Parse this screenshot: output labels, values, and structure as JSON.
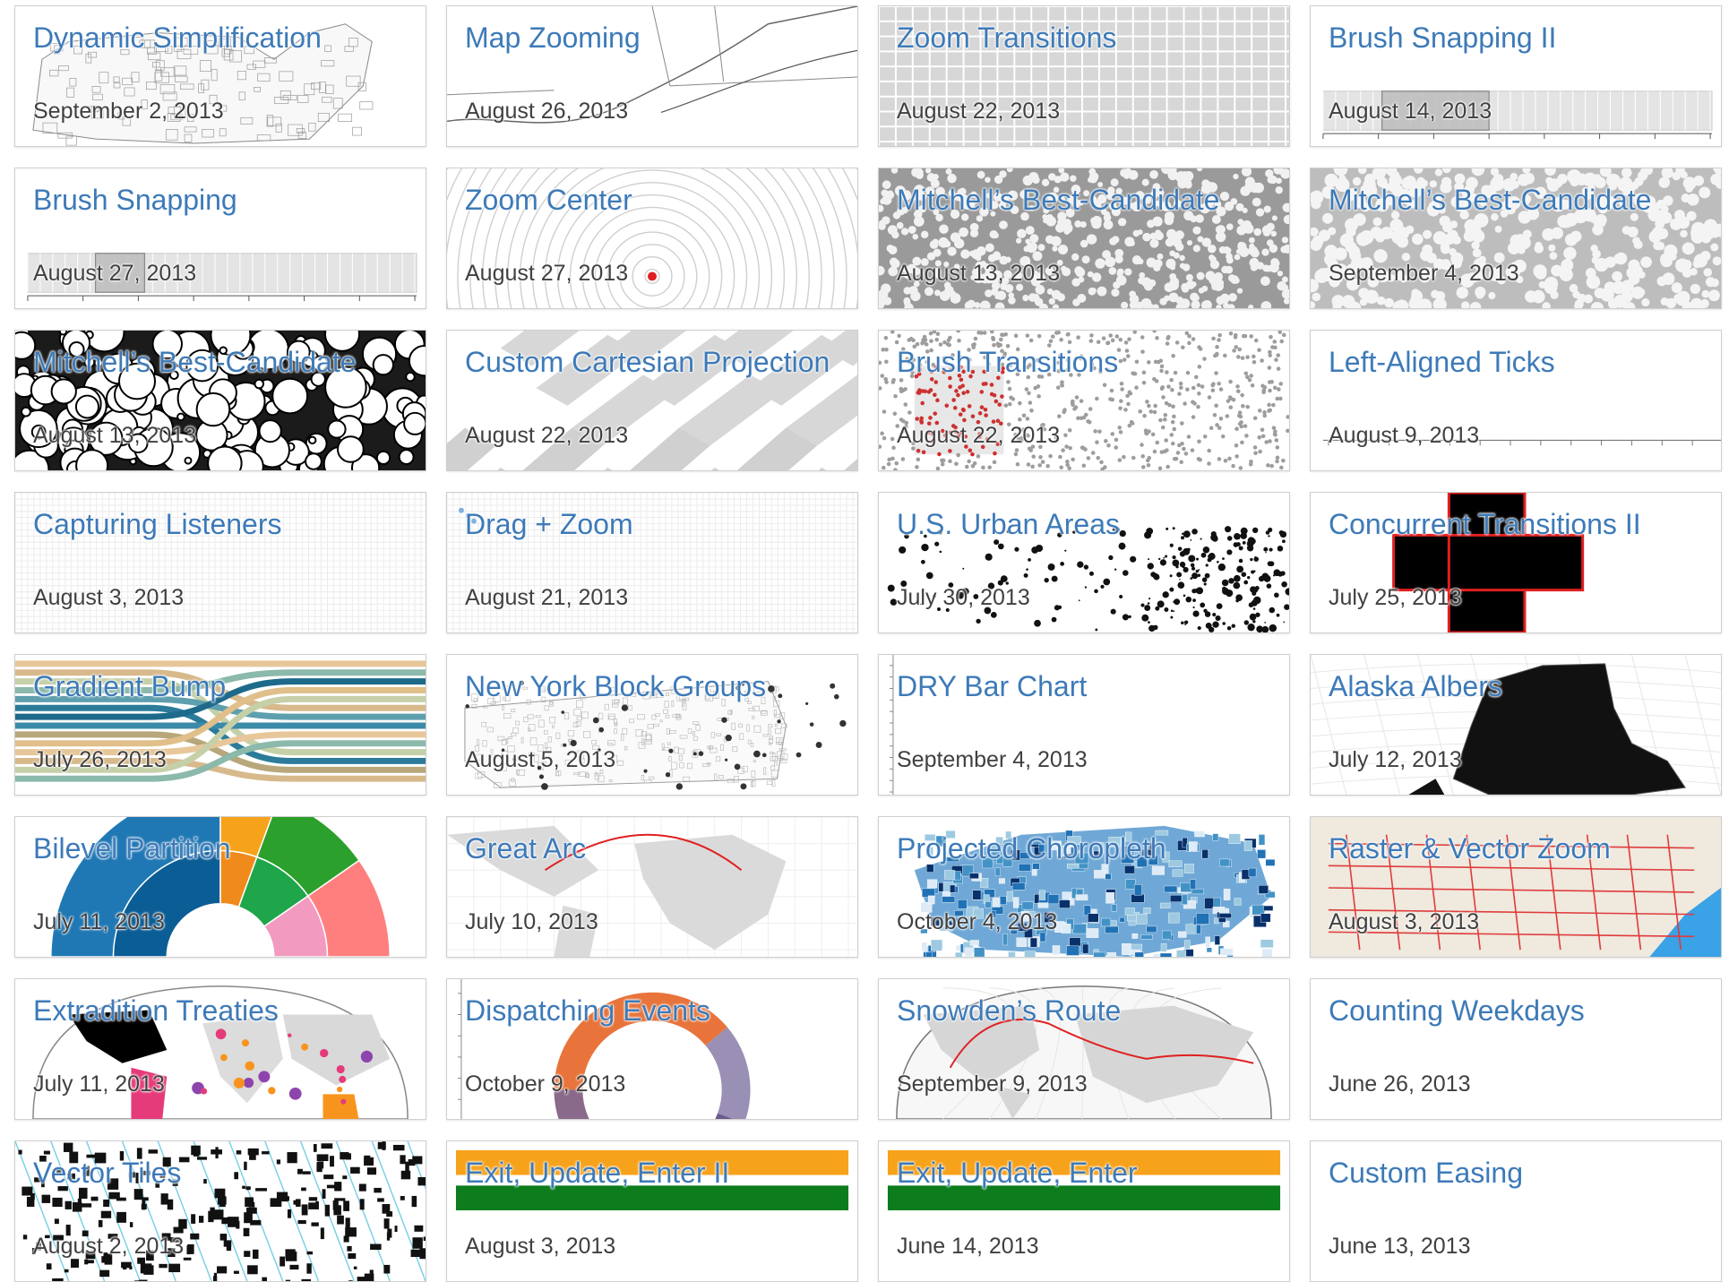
{
  "gallery": {
    "cards": [
      {
        "title": "Dynamic Simplification",
        "date": "September 2, 2013",
        "thumbnail": "us-counties-map"
      },
      {
        "title": "Map Zooming",
        "date": "August 26, 2013",
        "thumbnail": "coastline-map"
      },
      {
        "title": "Zoom Transitions",
        "date": "August 22, 2013",
        "thumbnail": "grid-tiles"
      },
      {
        "title": "Brush Snapping II",
        "date": "August 14, 2013",
        "thumbnail": "brush-timeline"
      },
      {
        "title": "Brush Snapping",
        "date": "August 27, 2013",
        "thumbnail": "brush-timeline"
      },
      {
        "title": "Zoom Center",
        "date": "August 27, 2013",
        "thumbnail": "concentric-circles"
      },
      {
        "title": "Mitchell’s Best-Candidate",
        "date": "August 13, 2013",
        "thumbnail": "dense-voronoi"
      },
      {
        "title": "Mitchell’s Best-Candidate",
        "date": "September 4, 2013",
        "thumbnail": "light-voronoi"
      },
      {
        "title": "Mitchell’s Best-Candidate",
        "date": "August 13, 2013",
        "thumbnail": "circle-packing"
      },
      {
        "title": "Custom Cartesian Projection",
        "date": "August 22, 2013",
        "thumbnail": "street-blocks"
      },
      {
        "title": "Brush Transitions",
        "date": "August 22, 2013",
        "thumbnail": "scatter-brush"
      },
      {
        "title": "Left-Aligned Ticks",
        "date": "August 9, 2013",
        "thumbnail": "time-axis"
      },
      {
        "title": "Capturing Listeners",
        "date": "August 3, 2013",
        "thumbnail": "fine-grid"
      },
      {
        "title": "Drag + Zoom",
        "date": "August 21, 2013",
        "thumbnail": "fine-grid-dots"
      },
      {
        "title": "U.S. Urban Areas",
        "date": "July 30, 2013",
        "thumbnail": "urban-dots-map"
      },
      {
        "title": "Concurrent Transitions II",
        "date": "July 25, 2013",
        "thumbnail": "black-cross"
      },
      {
        "title": "Gradient Bump",
        "date": "July 26, 2013",
        "thumbnail": "bump-streams"
      },
      {
        "title": "New York Block Groups",
        "date": "August 5, 2013",
        "thumbnail": "ny-block-map"
      },
      {
        "title": "DRY Bar Chart",
        "date": "September 4, 2013",
        "thumbnail": "bar-chart"
      },
      {
        "title": "Alaska Albers",
        "date": "July 12, 2013",
        "thumbnail": "alaska-map"
      },
      {
        "title": "Bilevel Partition",
        "date": "July 11, 2013",
        "thumbnail": "sunburst"
      },
      {
        "title": "Great Arc",
        "date": "July 10, 2013",
        "thumbnail": "world-arc"
      },
      {
        "title": "Projected Choropleth",
        "date": "October 4, 2013",
        "thumbnail": "us-choropleth"
      },
      {
        "title": "Raster & Vector Zoom",
        "date": "August 3, 2013",
        "thumbnail": "raster-map"
      },
      {
        "title": "Extradition Treaties",
        "date": "July 11, 2013",
        "thumbnail": "world-treaties"
      },
      {
        "title": "Dispatching Events",
        "date": "October 9, 2013",
        "thumbnail": "donut-chart"
      },
      {
        "title": "Snowden’s Route",
        "date": "September 9, 2013",
        "thumbnail": "world-route"
      },
      {
        "title": "Counting Weekdays",
        "date": "June 26, 2013",
        "thumbnail": "blank"
      },
      {
        "title": "Vector Tiles",
        "date": "August 2, 2013",
        "thumbnail": "vector-tiles"
      },
      {
        "title": "Exit, Update, Enter II",
        "date": "August 3, 2013",
        "thumbnail": "color-bars"
      },
      {
        "title": "Exit, Update, Enter",
        "date": "June 14, 2013",
        "thumbnail": "color-bars"
      },
      {
        "title": "Custom Easing",
        "date": "June 13, 2013",
        "thumbnail": "blank"
      }
    ]
  },
  "colors": {
    "title": "#3d7ab8",
    "date": "#404040",
    "card_border": "#cfcfcf",
    "accent_red": "#e02020",
    "bar_blue": "#3d7ab8",
    "orange": "#f7a21b",
    "green": "#0c7c1c"
  }
}
